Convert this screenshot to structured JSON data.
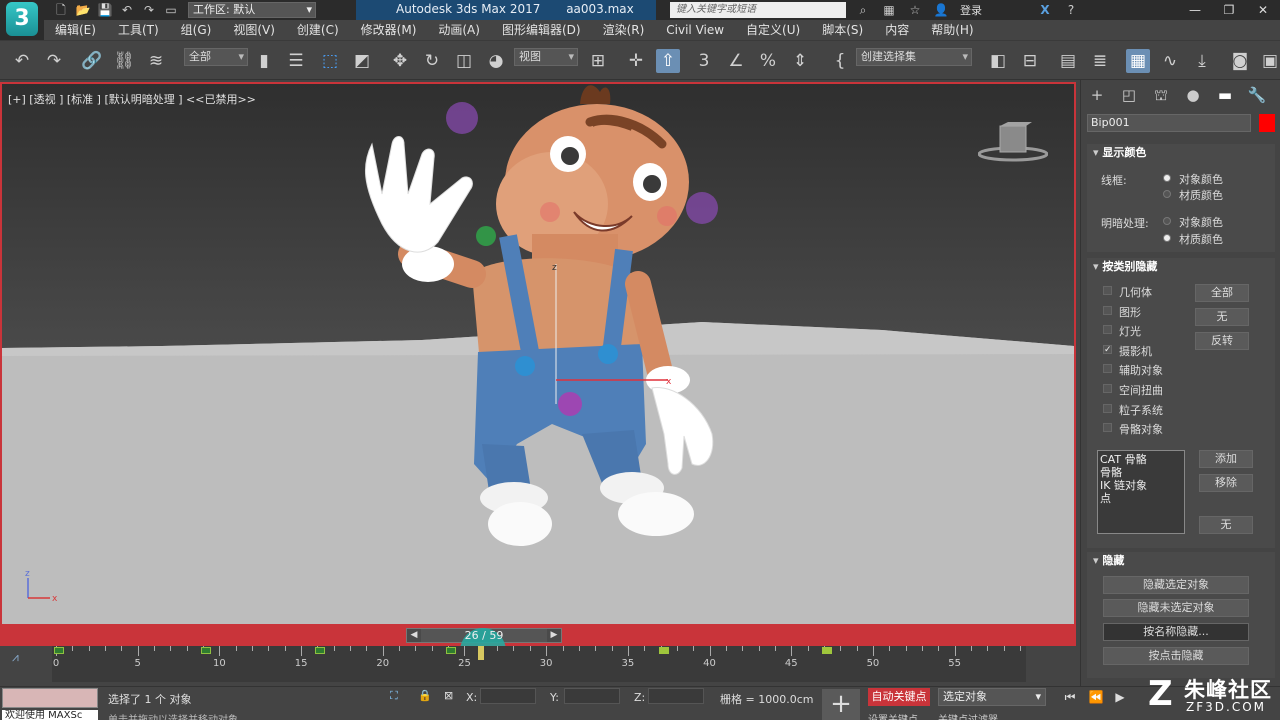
{
  "titlebar": {
    "logo": "3",
    "workspace": "工作区: 默认",
    "app_name": "Autodesk 3ds Max 2017",
    "file_name": "aa003.max",
    "search_placeholder": "键入关键字或短语",
    "login": "登录"
  },
  "menu": [
    "编辑(E)",
    "工具(T)",
    "组(G)",
    "视图(V)",
    "创建(C)",
    "修改器(M)",
    "动画(A)",
    "图形编辑器(D)",
    "渲染(R)",
    "Civil View",
    "自定义(U)",
    "脚本(S)",
    "内容",
    "帮助(H)"
  ],
  "toolbar": {
    "selection_filter": "全部",
    "ref_coord": "视图",
    "named_selection": "创建选择集"
  },
  "viewport": {
    "label": "[+] [透视 ] [标准 ] [默认明暗处理 ] <<已禁用>>",
    "border_color": "#c9343a",
    "axis_x": "x",
    "axis_z": "z"
  },
  "timeline": {
    "frame_label": "26 / 59",
    "current_frame": 26,
    "total_frames": 59,
    "ticks": [
      "0",
      "5",
      "10",
      "15",
      "20",
      "25",
      "30",
      "35",
      "40",
      "45",
      "50",
      "55"
    ],
    "key_frames_dark": [
      0,
      9,
      16,
      24
    ],
    "key_frames_green": [
      37,
      47
    ]
  },
  "status": {
    "max_script": "欢迎使用 MAXSc",
    "message": "选择了 1 个 对象",
    "message2": "单击并拖动以选择并移动对象",
    "x_label": "X:",
    "y_label": "Y:",
    "z_label": "Z:",
    "grid": "栅格 = 1000.0cm",
    "auto_key": "自动关键点",
    "set_key": "设置关键点",
    "selected_object": "选定对象",
    "key_filter": "关键点过滤器..."
  },
  "panel": {
    "object_name": "Bip001",
    "object_color": "#ff0000",
    "display_color": {
      "title": "显示颜色",
      "wireframe_label": "线框:",
      "shaded_label": "明暗处理:",
      "object_color": "对象颜色",
      "material_color": "材质颜色"
    },
    "hide_by_category": {
      "title": "按类别隐藏",
      "items": [
        "几何体",
        "图形",
        "灯光",
        "摄影机",
        "辅助对象",
        "空间扭曲",
        "粒子系统",
        "骨骼对象"
      ],
      "checked": [
        false,
        false,
        false,
        true,
        false,
        false,
        false,
        false
      ],
      "btn_all": "全部",
      "btn_none": "无",
      "btn_invert": "反转",
      "list": [
        "CAT 骨骼",
        "骨骼",
        "IK 链对象",
        "点"
      ],
      "btn_add": "添加",
      "btn_remove": "移除",
      "btn_none2": "无"
    },
    "hide": {
      "title": "隐藏",
      "btn1": "隐藏选定对象",
      "btn2": "隐藏未选定对象",
      "btn3": "按名称隐藏...",
      "btn4": "按点击隐藏"
    }
  },
  "watermark": {
    "name": "朱峰社区",
    "url": "ZF3D.COM"
  }
}
